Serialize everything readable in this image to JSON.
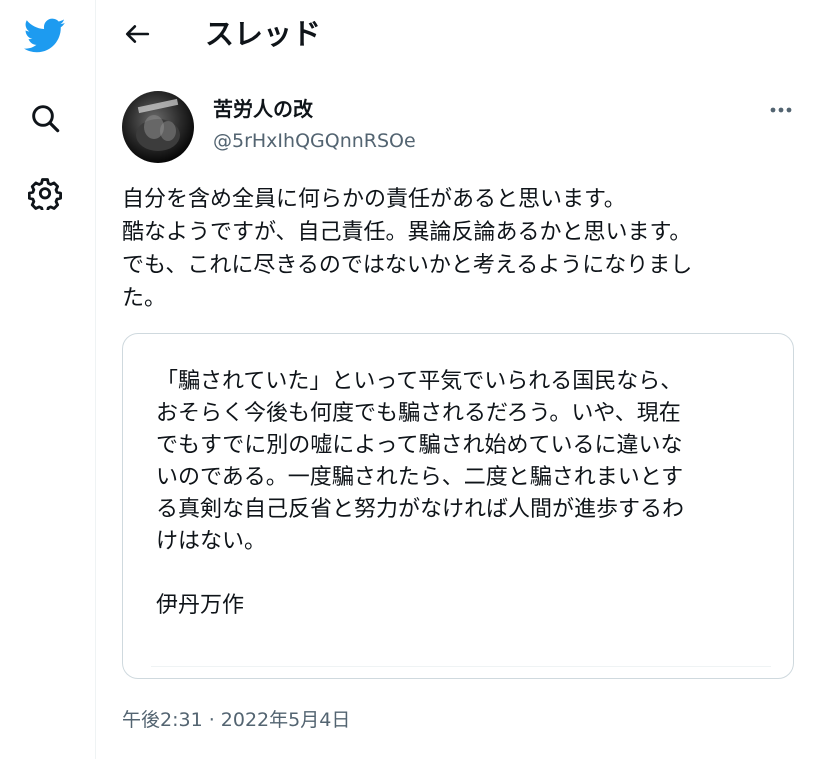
{
  "header": {
    "title": "スレッド"
  },
  "tweet": {
    "author_name": "苦労人の改",
    "author_handle": "@5rHxIhQGQnnRSOe",
    "text_lines": [
      "自分を含め全員に何らかの責任があると思います。",
      "酷なようですが、自己責任。異論反論あるかと思います。",
      "でも、これに尽きるのではないかと考えるようになりまし",
      "た。"
    ],
    "quote_lines": [
      "「騙されていた」といって平気でいられる国民なら、",
      "おそらく今後も何度でも騙されるだろう。いや、現在",
      "でもすでに別の嘘によって騙され始めているに違いな",
      "いのである。一度騙されたら、二度と騙されまいとす",
      "る真剣な自己反省と努力がなければ人間が進歩するわ",
      "けはない。",
      "",
      "伊丹万作"
    ],
    "timestamp": "午後2:31 · 2022年5月4日"
  },
  "colors": {
    "brand": "#1d9bf0",
    "text": "#0f1419",
    "secondary": "#536471",
    "border": "#cfd9de"
  },
  "icons": {
    "logo": "twitter-bird-icon",
    "explore": "search-icon",
    "settings": "gear-icon",
    "back": "arrow-left-icon",
    "more": "more-horizontal-icon"
  }
}
